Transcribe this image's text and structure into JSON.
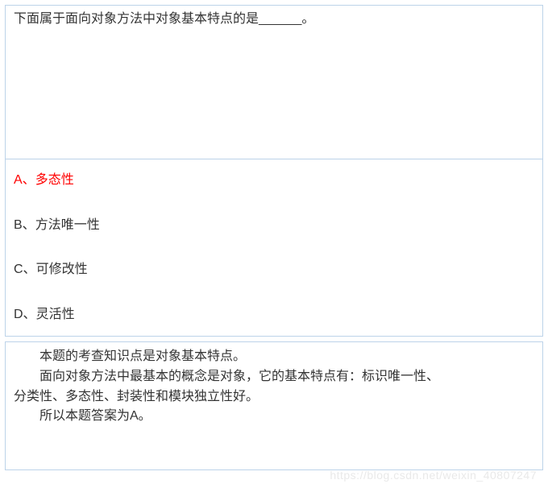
{
  "question": {
    "stem": "下面属于面向对象方法中对象基本特点的是______。"
  },
  "options": [
    {
      "label": "A、",
      "text": "多态性",
      "correct": true
    },
    {
      "label": "B、",
      "text": "方法唯一性",
      "correct": false
    },
    {
      "label": "C、",
      "text": "可修改性",
      "correct": false
    },
    {
      "label": "D、",
      "text": "灵活性",
      "correct": false
    }
  ],
  "explanation": {
    "line1": "本题的考查知识点是对象基本特点。",
    "line2": "面向对象方法中最基本的概念是对象，它的基本特点有：标识唯一性、分类性、多态性、封装性和模块独立性好。",
    "line2_part1": "面向对象方法中最基本的概念是对象，它的基本特点有：标识唯一性、",
    "line2_part2": "分类性、多态性、封装性和模块独立性好。",
    "line3": "所以本题答案为A。"
  },
  "watermark": "https://blog.csdn.net/weixin_40807247"
}
